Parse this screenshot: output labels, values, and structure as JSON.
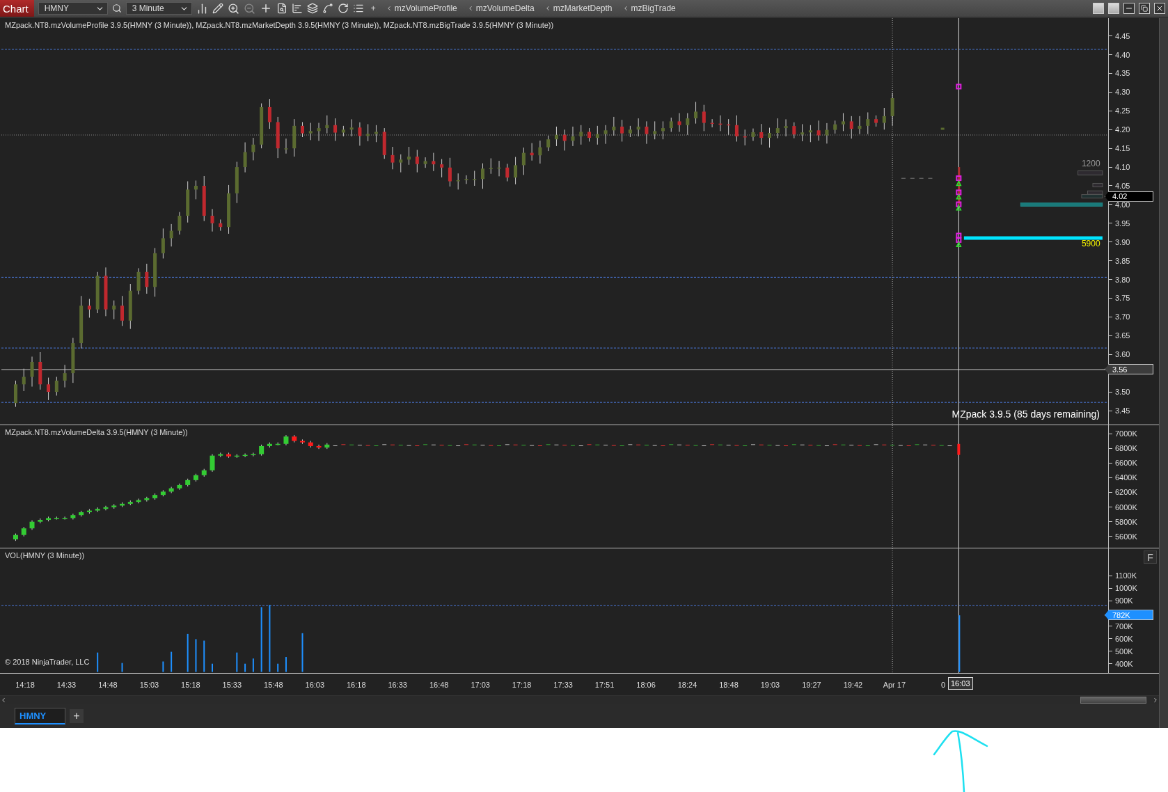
{
  "toolbar": {
    "app_tab": "Chart",
    "instrument": "HMNY",
    "interval": "3 Minute",
    "add_label": "+",
    "indicators": [
      {
        "label": "mzVolumeProfile"
      },
      {
        "label": "mzVolumeDelta"
      },
      {
        "label": "mzMarketDepth"
      },
      {
        "label": "mzBigTrade"
      }
    ]
  },
  "price_panel": {
    "title": "MZpack.NT8.mzVolumeProfile 3.9.5(HMNY (3 Minute)), MZpack.NT8.mzMarketDepth 3.9.5(HMNY (3 Minute)), MZpack.NT8.mzBigTrade 3.9.5(HMNY (3 Minute))",
    "y_ticks": [
      "4.45",
      "4.40",
      "4.35",
      "4.30",
      "4.25",
      "4.20",
      "4.15",
      "4.10",
      "4.05",
      "4.00",
      "3.95",
      "3.90",
      "3.85",
      "3.80",
      "3.75",
      "3.70",
      "3.65",
      "3.60",
      "3.50",
      "3.45"
    ],
    "depth_label": "1200",
    "big_trade_label": "5900",
    "current_price": "4.02",
    "line_price": "3.56",
    "trial_notice": "MZpack 3.9.5  (85 days remaining)"
  },
  "delta_panel": {
    "title": "MZpack.NT8.mzVolumeDelta 3.9.5(HMNY (3 Minute))",
    "y_ticks": [
      "7000K",
      "6800K",
      "6600K",
      "6400K",
      "6200K",
      "6000K",
      "5800K",
      "5600K"
    ]
  },
  "volume_panel": {
    "title": "VOL(HMNY (3 Minute))",
    "y_ticks": [
      "1100K",
      "1000K",
      "900K",
      "700K",
      "600K",
      "500K",
      "400K"
    ],
    "current_volume": "782K",
    "copyright": "© 2018 NinjaTrader, LLC",
    "f_button": "F"
  },
  "time_axis": {
    "labels": [
      "14:18",
      "14:33",
      "14:48",
      "15:03",
      "15:18",
      "15:33",
      "15:48",
      "16:03",
      "16:18",
      "16:33",
      "16:48",
      "17:03",
      "17:18",
      "17:33",
      "17:51",
      "18:06",
      "18:24",
      "18:48",
      "19:03",
      "19:27",
      "19:42",
      "Apr 17"
    ],
    "partial_label": "0",
    "cursor_time": "16:03"
  },
  "tabs": [
    {
      "label": "HMNY",
      "selected": true
    }
  ],
  "add_tab": "+"
}
